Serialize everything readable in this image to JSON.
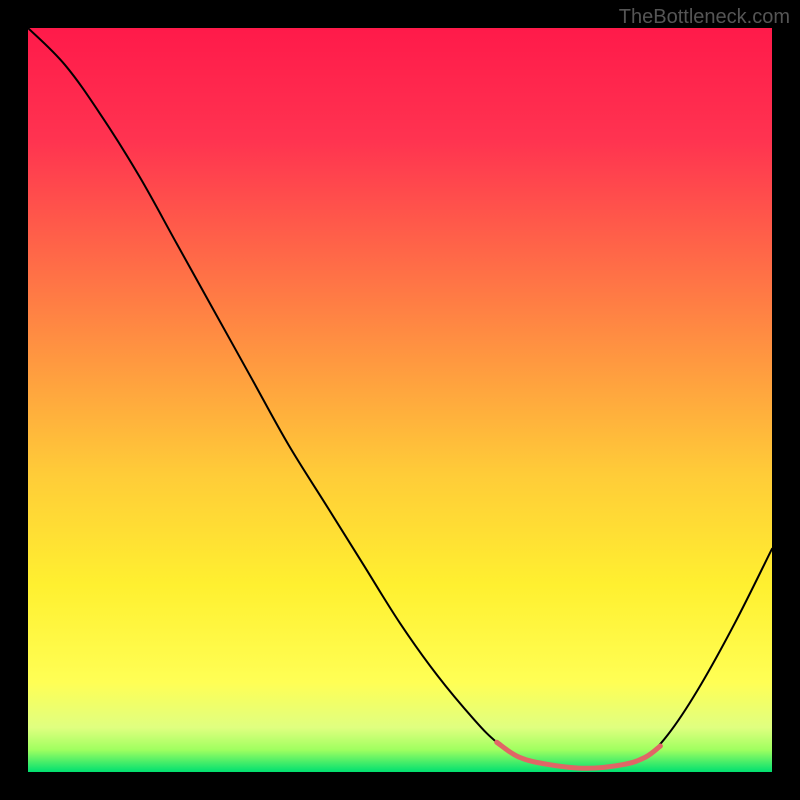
{
  "watermark": "TheBottleneck.com",
  "chart_data": {
    "type": "line",
    "title": "",
    "xlabel": "",
    "ylabel": "",
    "xlim": [
      0,
      100
    ],
    "ylim": [
      0,
      100
    ],
    "gradient_stops": [
      {
        "offset": 0,
        "color": "#ff1a4a"
      },
      {
        "offset": 15,
        "color": "#ff3350"
      },
      {
        "offset": 30,
        "color": "#ff6648"
      },
      {
        "offset": 45,
        "color": "#ff9940"
      },
      {
        "offset": 60,
        "color": "#ffcc38"
      },
      {
        "offset": 75,
        "color": "#fff030"
      },
      {
        "offset": 88,
        "color": "#ffff55"
      },
      {
        "offset": 94,
        "color": "#e0ff80"
      },
      {
        "offset": 97,
        "color": "#a0ff60"
      },
      {
        "offset": 100,
        "color": "#00e070"
      }
    ],
    "series": [
      {
        "name": "main-curve",
        "stroke": "#000000",
        "stroke_width": 2,
        "points": [
          {
            "x": 0,
            "y": 100
          },
          {
            "x": 5,
            "y": 95
          },
          {
            "x": 10,
            "y": 88
          },
          {
            "x": 15,
            "y": 80
          },
          {
            "x": 20,
            "y": 71
          },
          {
            "x": 25,
            "y": 62
          },
          {
            "x": 30,
            "y": 53
          },
          {
            "x": 35,
            "y": 44
          },
          {
            "x": 40,
            "y": 36
          },
          {
            "x": 45,
            "y": 28
          },
          {
            "x": 50,
            "y": 20
          },
          {
            "x": 55,
            "y": 13
          },
          {
            "x": 60,
            "y": 7
          },
          {
            "x": 63,
            "y": 4
          },
          {
            "x": 66,
            "y": 2
          },
          {
            "x": 70,
            "y": 1
          },
          {
            "x": 75,
            "y": 0.5
          },
          {
            "x": 80,
            "y": 1
          },
          {
            "x": 83,
            "y": 2
          },
          {
            "x": 86,
            "y": 5
          },
          {
            "x": 90,
            "y": 11
          },
          {
            "x": 95,
            "y": 20
          },
          {
            "x": 100,
            "y": 30
          }
        ]
      },
      {
        "name": "highlight-segment",
        "stroke": "#e06666",
        "stroke_width": 5,
        "points": [
          {
            "x": 63,
            "y": 4
          },
          {
            "x": 66,
            "y": 2
          },
          {
            "x": 70,
            "y": 1
          },
          {
            "x": 75,
            "y": 0.5
          },
          {
            "x": 80,
            "y": 1
          },
          {
            "x": 83,
            "y": 2
          },
          {
            "x": 85,
            "y": 3.5
          }
        ]
      }
    ]
  }
}
